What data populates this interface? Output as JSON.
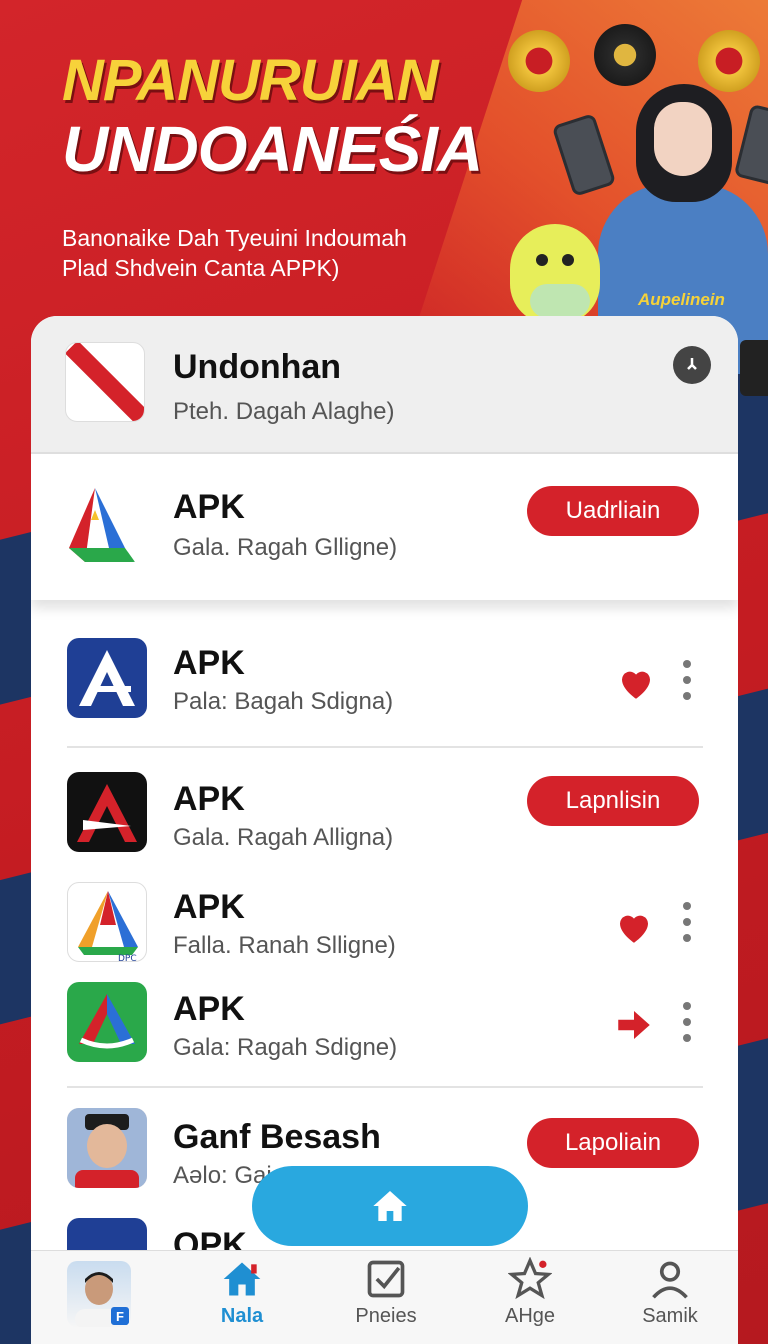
{
  "banner": {
    "headline_line1": "NPANURUIAN",
    "headline_line2": "UNDOANEŚIA",
    "subtitle_line1": "Banonaike Dah Tyeuini Indoumah",
    "subtitle_line2": "Plad Shdvein Canta APPK)",
    "shirt_text": "Aupelinein"
  },
  "header_app": {
    "title": "Undonhan",
    "subtitle": "Pteh. Dagah Alaghe)",
    "close_icon": "close-icon"
  },
  "apps": [
    {
      "title": "APK",
      "subtitle": "Gala. Ragah Glligne)",
      "action_label": "Uadrliain",
      "icon": "drive-triangle-icon"
    },
    {
      "title": "APK",
      "subtitle": "Pala: Bagah Sdigna)",
      "icon": "blue-a-icon",
      "trailing": "heart-icon"
    },
    {
      "title": "APK",
      "subtitle": "Gala. Ragah Alligna)",
      "action_label": "Lapnlisin",
      "icon": "black-a-icon"
    },
    {
      "title": "APK",
      "subtitle": "Falla. Ranah Slligne)",
      "icon": "multicolor-triangle-icon",
      "trailing": "heart-icon"
    },
    {
      "title": "APK",
      "subtitle": "Gala: Ragah Sdigne)",
      "icon": "green-a-icon",
      "trailing": "share-arrow-icon"
    },
    {
      "title": "Ganf Besash",
      "subtitle": "Aəlo: Gai",
      "action_label": "Lapoliain",
      "icon": "person-photo"
    },
    {
      "title": "OPK",
      "subtitle": "",
      "icon": "blue-a-icon"
    }
  ],
  "badge": {
    "avatar_label": "F"
  },
  "nav": {
    "items": [
      {
        "label": "Nala",
        "icon": "home-icon",
        "active": true
      },
      {
        "label": "Pneies",
        "icon": "checkbox-icon",
        "active": false
      },
      {
        "label": "AHge",
        "icon": "star-icon",
        "active": false
      },
      {
        "label": "Samik",
        "icon": "profile-icon",
        "active": false
      }
    ]
  },
  "colors": {
    "accent_red": "#d4222a",
    "navy": "#1d3563",
    "active_blue": "#1f8fd2",
    "fab_blue": "#29a8df",
    "headline_yellow": "#f7d23a"
  }
}
